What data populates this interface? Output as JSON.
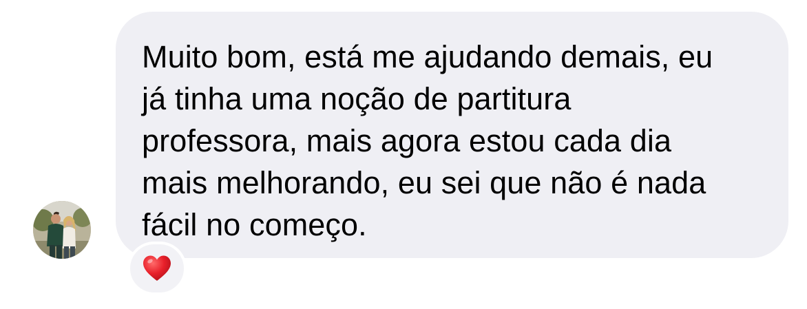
{
  "message": {
    "text": "Muito bom, está me ajudando demais, eu\njá tinha uma noção de partitura\nprofessora, mais agora estou cada dia\nmais melhorando, eu sei que não é nada\nfácil no começo."
  },
  "sender": {
    "avatar_icon": "profile-photo"
  },
  "reaction": {
    "icon": "red-heart-icon",
    "color": "#e8202a"
  },
  "colors": {
    "bubble_background": "#efeff4",
    "page_background": "#ffffff",
    "text": "#000000"
  }
}
